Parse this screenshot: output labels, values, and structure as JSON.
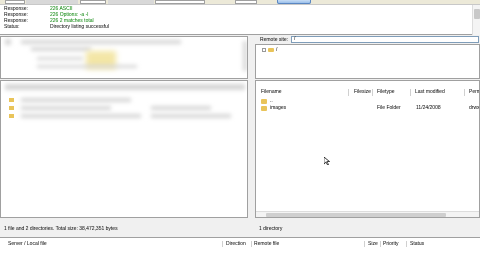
{
  "message_log": [
    {
      "tag": "Response:",
      "message": "226 ASCII",
      "color": "#008000"
    },
    {
      "tag": "Response:",
      "message": "226 Options: -a -l",
      "color": "#008000"
    },
    {
      "tag": "Response:",
      "message": "226 2 matches total",
      "color": "#008000"
    },
    {
      "tag": "Status:",
      "message": "Directory listing successful",
      "color": "#000000"
    }
  ],
  "remote": {
    "site_label": "Remote site:",
    "site_path": "/",
    "tree_root": "/",
    "columns": [
      "Filename",
      "Filesize",
      "Filetype",
      "Last modified",
      "Perm"
    ],
    "rows": [
      {
        "name": "..",
        "size": "",
        "type": "",
        "modified": "",
        "perm": ""
      },
      {
        "name": "images",
        "size": "",
        "type": "File Folder",
        "modified": "11/24/2008",
        "perm": "drwx"
      }
    ],
    "status": "1 directory"
  },
  "local": {
    "status": "1 file and 2 directories. Total size: 38,472,351 bytes"
  },
  "queue": {
    "columns": [
      "Server / Local file",
      "Direction",
      "Remote file",
      "Size",
      "Priority",
      "Status"
    ]
  },
  "colors": {
    "log_green": "#008000",
    "folder": "#e9c45a",
    "accent": "#7f9db9"
  },
  "icons": {
    "folder": "folder-icon",
    "expander": "tree-expander-icon",
    "cursor": "mouse-cursor-icon"
  }
}
